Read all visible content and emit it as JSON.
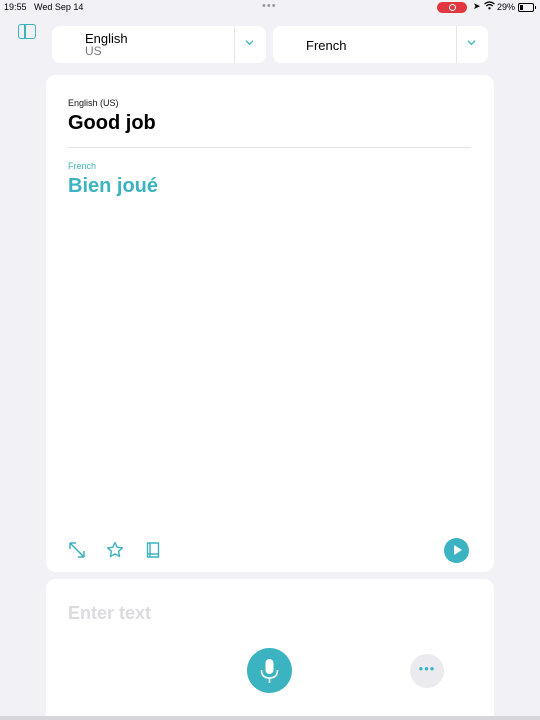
{
  "status_bar": {
    "time": "19:55",
    "date": "Wed Sep 14",
    "battery": "29%"
  },
  "source_language": {
    "name": "English",
    "region": "US"
  },
  "target_language": {
    "name": "French"
  },
  "translation": {
    "source_label": "English (US)",
    "source_text": "Good job",
    "target_label": "French",
    "target_text": "Bien joué"
  },
  "input": {
    "placeholder": "Enter text"
  },
  "colors": {
    "accent": "#3cb3c0",
    "background": "#f2f1f6"
  },
  "icons": {
    "sidebar": "sidebar-icon",
    "expand": "expand-icon",
    "favorite": "star-icon",
    "dictionary": "book-icon",
    "play": "play-icon",
    "microphone": "microphone-icon",
    "more": "ellipsis-icon"
  }
}
